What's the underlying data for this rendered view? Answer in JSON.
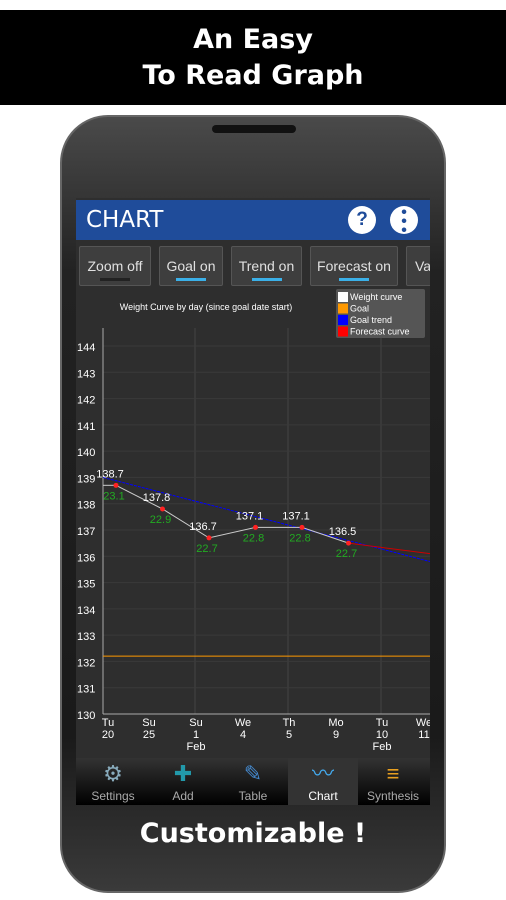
{
  "banner": {
    "line1": "An Easy",
    "line2": "To Read Graph"
  },
  "footer_text": "Customizable !",
  "appbar": {
    "title": "CHART",
    "help_icon": "?",
    "menu_icon": "more-vertical"
  },
  "toggles": [
    {
      "label": "Zoom off",
      "on": false
    },
    {
      "label": "Goal on",
      "on": true
    },
    {
      "label": "Trend on",
      "on": true
    },
    {
      "label": "Forecast on",
      "on": true
    },
    {
      "label": "Va",
      "on": true
    }
  ],
  "tabs": [
    {
      "label": "Settings",
      "icon": "gear-icon"
    },
    {
      "label": "Add",
      "icon": "add-icon"
    },
    {
      "label": "Table",
      "icon": "notepad-icon"
    },
    {
      "label": "Chart",
      "icon": "chart-icon",
      "active": true
    },
    {
      "label": "Synthesis",
      "icon": "document-icon"
    }
  ],
  "colors": {
    "appbar": "#1f4c9a",
    "weight": "#ffffff",
    "goal": "#ff9900",
    "trend": "#0000ff",
    "forecast": "#ff0000",
    "bmi": "#22aa22"
  },
  "chart_data": {
    "type": "line",
    "title": "Weight Curve by day (since goal date start)",
    "legend": [
      "Weight curve",
      "Goal",
      "Goal trend",
      "Forecast curve"
    ],
    "legend_position": "top-right",
    "ylim": [
      130,
      144
    ],
    "yticks": [
      130,
      131,
      132,
      133,
      134,
      135,
      136,
      137,
      138,
      139,
      140,
      141,
      142,
      143,
      144
    ],
    "xticks": [
      [
        "Tu",
        "20",
        ""
      ],
      [
        "Su",
        "25",
        ""
      ],
      [
        "Su",
        "1",
        "Feb"
      ],
      [
        "We",
        "4",
        ""
      ],
      [
        "Th",
        "5",
        ""
      ],
      [
        "Mo",
        "9",
        ""
      ],
      [
        "Tu",
        "10",
        "Feb"
      ],
      [
        "We",
        "11",
        ""
      ]
    ],
    "grid": true,
    "weight": [
      138.7,
      137.8,
      136.7,
      137.1,
      137.1,
      136.5
    ],
    "weight_labels": [
      "138.7",
      "137.8",
      "136.7",
      "137.1",
      "137.1",
      "136.5"
    ],
    "bmi_labels": [
      "23.1",
      "22.9",
      "22.7",
      "22.8",
      "22.8",
      "22.7"
    ],
    "goal": 132.2,
    "goal_trend": [
      139.0,
      135.8
    ],
    "forecast": [
      136.5,
      136.1
    ]
  }
}
